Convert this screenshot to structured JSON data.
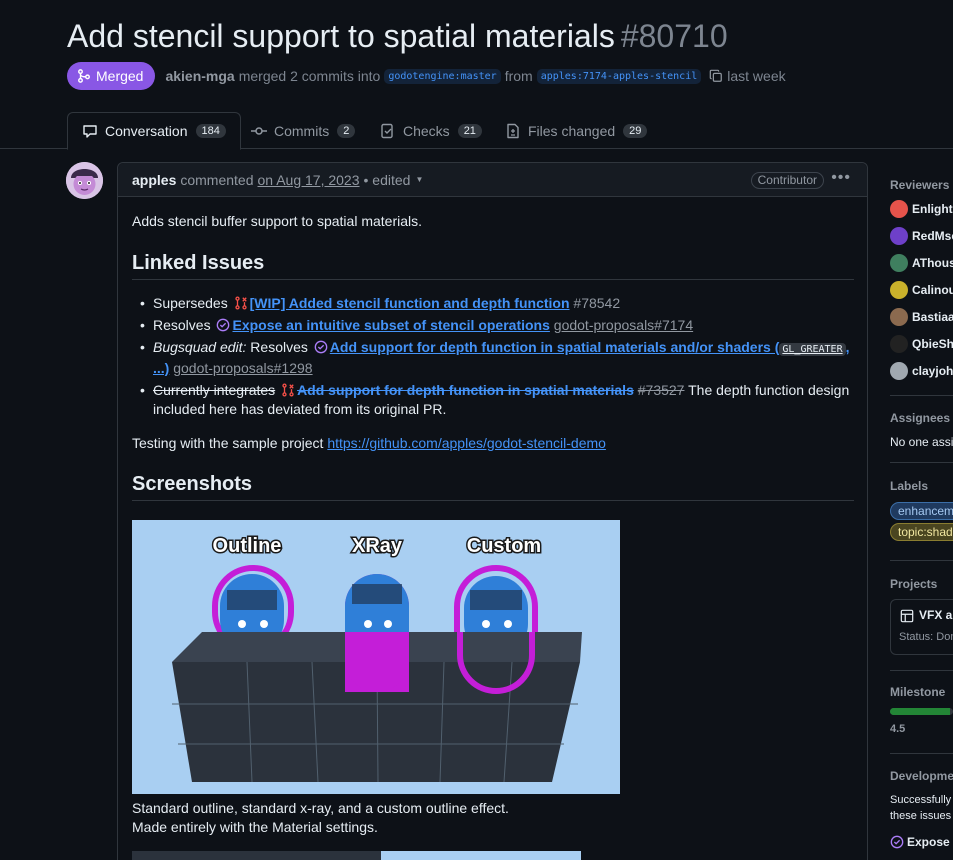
{
  "pr": {
    "title": "Add stencil support to spatial materials",
    "number": "#80710",
    "status": "Merged",
    "author": "akien-mga",
    "merge_text": "merged 2 commits into",
    "base_branch": "godotengine:master",
    "from_text": "from",
    "head_branch": "apples:7174-apples-stencil",
    "when": "last week"
  },
  "tabs": [
    {
      "label": "Conversation",
      "count": "184"
    },
    {
      "label": "Commits",
      "count": "2"
    },
    {
      "label": "Checks",
      "count": "21"
    },
    {
      "label": "Files changed",
      "count": "29"
    }
  ],
  "comment": {
    "user": "apples",
    "action": "commented",
    "date": "on Aug 17, 2023",
    "edited": "• edited",
    "role": "Contributor",
    "intro": "Adds stencil buffer support to spatial materials.",
    "linked_heading": "Linked Issues",
    "items": [
      {
        "prefix": "Supersedes",
        "link": "[WIP] Added stencil function and depth function",
        "ref": "#78542"
      },
      {
        "prefix": "Resolves",
        "link": "Expose an intuitive subset of stencil operations",
        "ref": "godot-proposals#7174"
      },
      {
        "prefix_em": "Bugsquad edit:",
        "prefix": "Resolves",
        "link": "Add support for depth function in spatial materials and/or shaders (",
        "code": "GL_GREATER",
        "link_tail": ", ...)",
        "ref": "godot-proposals#1298"
      },
      {
        "prefix": "Currently integrates",
        "link": "Add support for depth function in spatial materials",
        "ref": "#73527",
        "suffix": "The depth function design included here has deviated from its original PR."
      }
    ],
    "testing_text": "Testing with the sample project",
    "testing_url": "https://github.com/apples/godot-stencil-demo",
    "screens_heading": "Screenshots",
    "screenshot_labels": [
      "Outline",
      "XRay",
      "Custom"
    ],
    "caption_line1": "Standard outline, standard x-ray, and a custom outline effect.",
    "caption_line2": "Made entirely with the Material settings."
  },
  "sidebar": {
    "reviewers_title": "Reviewers",
    "reviewers": [
      {
        "name": "Enlighte",
        "color": "#e5534b"
      },
      {
        "name": "RedMse",
        "color": "#6e40c9"
      },
      {
        "name": "AThousa",
        "color": "#3f7f5f"
      },
      {
        "name": "Calinou",
        "color": "#c9b12b"
      },
      {
        "name": "Bastiaan",
        "color": "#8b6a4f"
      },
      {
        "name": "QbieSha",
        "color": "#222222"
      },
      {
        "name": "clayjohn",
        "color": "#a0a8b0"
      }
    ],
    "assignees_title": "Assignees",
    "assignees_value": "No one assig",
    "labels_title": "Labels",
    "labels": [
      {
        "name": "enhanceme",
        "bg": "#1f3a5f",
        "fg": "#a5c8f0",
        "border": "#3b6ea8"
      },
      {
        "name": "topic:shade",
        "bg": "#4a4520",
        "fg": "#f0e6a0",
        "border": "#8a7d30"
      }
    ],
    "projects_title": "Projects",
    "project_name": "VFX an",
    "project_status": "Status: Don",
    "milestone_title": "Milestone",
    "milestone_value": "4.5",
    "milestone_progress": 0.95,
    "development_title": "Development",
    "development_text1": "Successfully",
    "development_text2": "these issues",
    "development_link": "Expose a"
  },
  "colors": {
    "merged": "#8957e5",
    "link": "#4493f8",
    "progress": "#238636"
  }
}
